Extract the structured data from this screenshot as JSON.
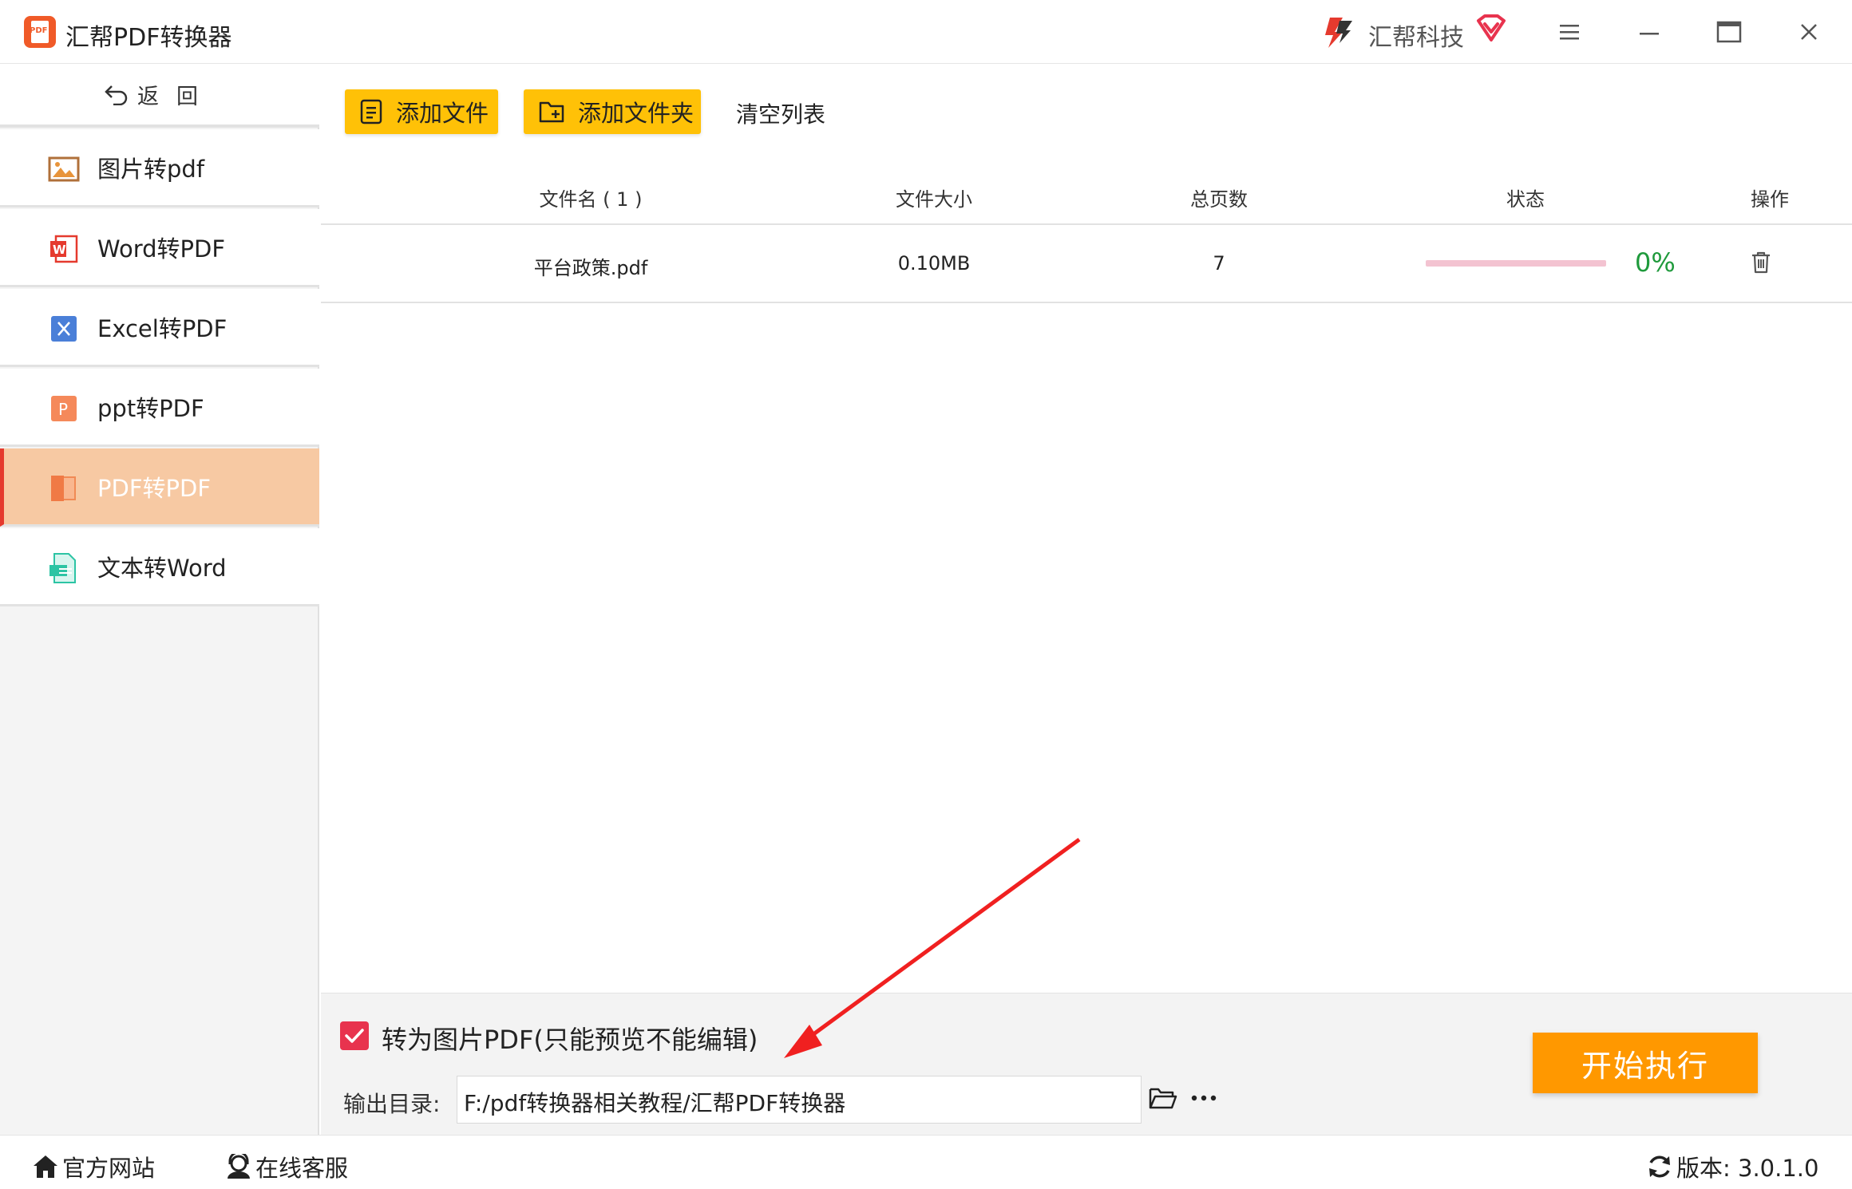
{
  "app": {
    "title": "汇帮PDF转换器",
    "logo_text": "PDF",
    "brand": "汇帮科技"
  },
  "window_controls": [
    "menu-icon",
    "minimize-icon",
    "maximize-icon",
    "close-icon"
  ],
  "sidebar": {
    "back_label": "返回",
    "items": [
      {
        "label": "图片转pdf",
        "icon": "image-icon"
      },
      {
        "label": "Word转PDF",
        "icon": "word-icon"
      },
      {
        "label": "Excel转PDF",
        "icon": "excel-icon"
      },
      {
        "label": "ppt转PDF",
        "icon": "ppt-icon"
      },
      {
        "label": "PDF转PDF",
        "icon": "pdf-icon",
        "active": true
      },
      {
        "label": "文本转Word",
        "icon": "text-icon"
      }
    ]
  },
  "toolbar": {
    "add_file": "添加文件",
    "add_folder": "添加文件夹",
    "clear_list": "清空列表"
  },
  "table": {
    "headers": {
      "name": "文件名 ( 1 )",
      "size": "文件大小",
      "pages": "总页数",
      "status": "状态",
      "action": "操作"
    },
    "rows": [
      {
        "name": "平台政策.pdf",
        "size": "0.10MB",
        "pages": "7",
        "progress": 0,
        "progress_text": "0%"
      }
    ]
  },
  "options": {
    "image_pdf_label": "转为图片PDF(只能预览不能编辑)",
    "image_pdf_checked": true,
    "output_label": "输出目录:",
    "output_path": "F:/pdf转换器相关教程/汇帮PDF转换器"
  },
  "start_label": "开始执行",
  "statusbar": {
    "website": "官方网站",
    "support": "在线客服",
    "version": "版本: 3.0.1.0"
  },
  "colors": {
    "accent_yellow": "#ffc107",
    "start_orange": "#ff9800",
    "active_nav": "#f7c9a3",
    "checkbox_red": "#e8334e",
    "progress_pink": "#f3c3d1",
    "percent_green": "#1f9a3c"
  }
}
